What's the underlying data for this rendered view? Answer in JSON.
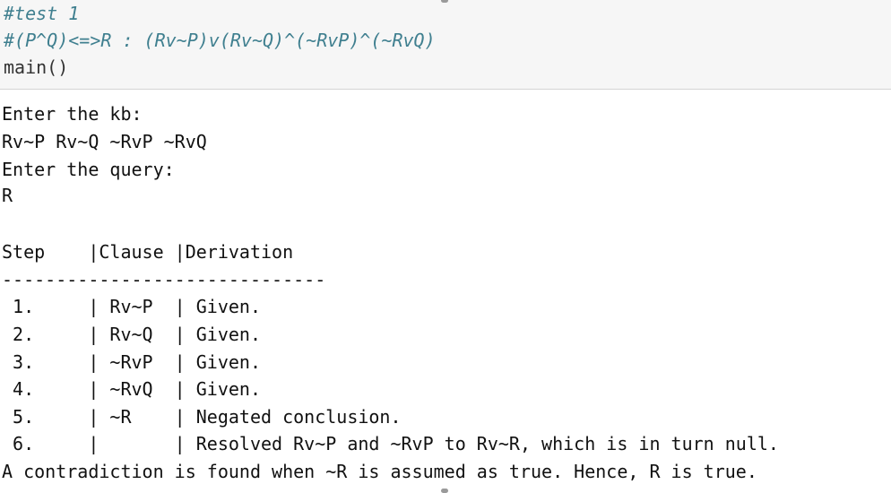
{
  "code_cell": {
    "lines": [
      "#test 1",
      "#(P^Q)<=>R : (Rv~P)v(Rv~Q)^(~RvP)^(~RvQ)",
      "main()"
    ]
  },
  "output": {
    "prompt_kb": "Enter the kb:",
    "kb_value": "Rv~P Rv~Q ~RvP ~RvQ",
    "prompt_query": "Enter the query:",
    "query_value": "R",
    "table_header": "Step    |Clause |Derivation",
    "separator": "------------------------------",
    "rows": [
      " 1.     | Rv~P  | Given.",
      " 2.     | Rv~Q  | Given.",
      " 3.     | ~RvP  | Given.",
      " 4.     | ~RvQ  | Given.",
      " 5.     | ~R    | Negated conclusion.",
      " 6.     |       | Resolved Rv~P and ~RvP to Rv~R, which is in turn null."
    ],
    "conclusion": "A contradiction is found when ~R is assumed as true. Hence, R is true."
  }
}
